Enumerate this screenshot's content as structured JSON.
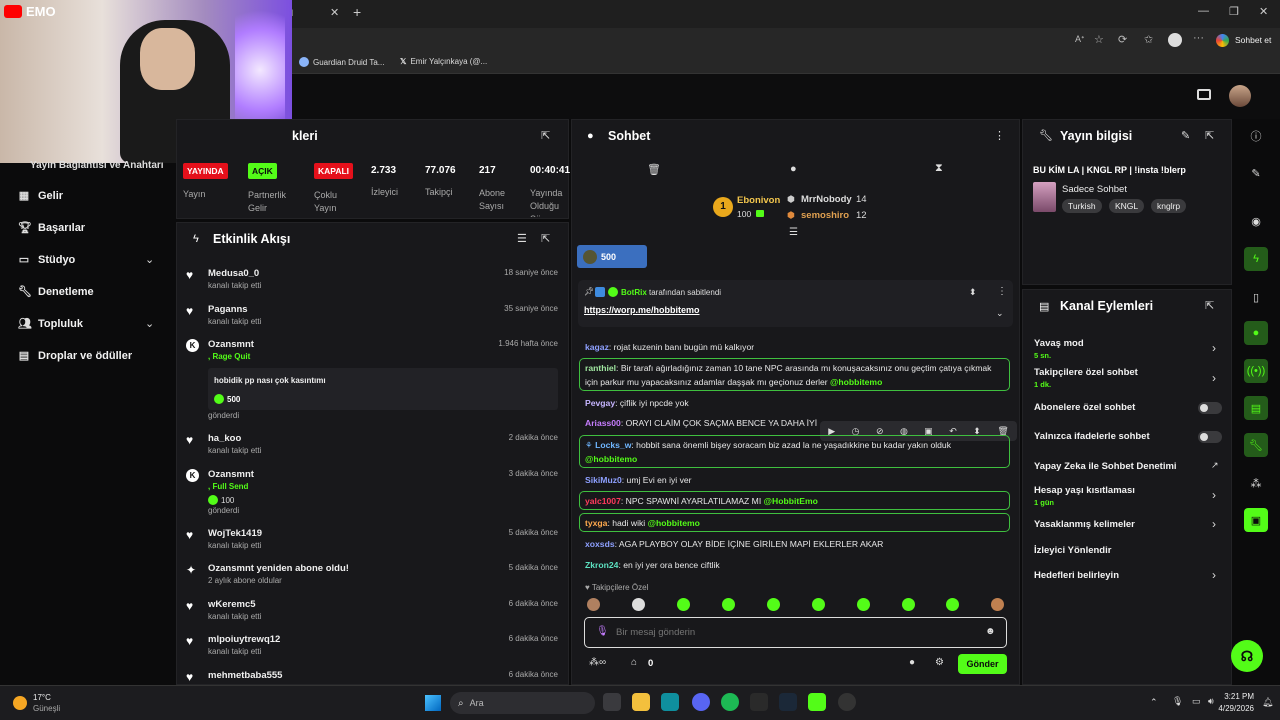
{
  "browser": {
    "tab_suffix": "d",
    "favorites": [
      "Guardian Druid Ta...",
      "Emir Yalçınkaya (@..."
    ],
    "chat_button": "Sohbet et"
  },
  "webcam": {
    "logo_text": "EMO"
  },
  "left_nav": {
    "partial_top": "Yayın Bağlantısı ve Anahtarı",
    "items": [
      {
        "label": "Gelir",
        "icon": "money-icon"
      },
      {
        "label": "Başarılar",
        "icon": "trophy-icon"
      },
      {
        "label": "Stüdyo",
        "icon": "studio-icon"
      },
      {
        "label": "Denetleme",
        "icon": "wrench-icon"
      },
      {
        "label": "Topluluk",
        "icon": "community-icon"
      },
      {
        "label": "Droplar ve ödüller",
        "icon": "drops-icon"
      }
    ]
  },
  "stats_panel": {
    "title_partial": "kleri",
    "badges": [
      {
        "text": "YAYINDA",
        "label": "Yayın",
        "color": "#e5101b"
      },
      {
        "text": "AÇIK",
        "label": "Partnerlik Gelir",
        "color": "#53fc18"
      },
      {
        "text": "KAPALI",
        "label": "Çoklu Yayın",
        "color": "#e5101b"
      }
    ],
    "stats": [
      {
        "value": "2.733",
        "label": "İzleyici"
      },
      {
        "value": "77.076",
        "label": "Takipçi"
      },
      {
        "value": "217",
        "label": "Abone Sayısı"
      },
      {
        "value": "00:40:41",
        "label": "Yayında Olduğu Süre"
      }
    ]
  },
  "activity": {
    "title": "Etkinlik Akışı",
    "events": [
      {
        "name": "Medusa0_0",
        "sub": "kanalı takip etti",
        "time": "18 saniye önce",
        "type": "follow"
      },
      {
        "name": "Paganns",
        "sub": "kanalı takip etti",
        "time": "35 saniye önce",
        "type": "follow"
      },
      {
        "name": "Ozansmnt",
        "sub": ", Rage Quit",
        "time": "1.946 hafta önce",
        "type": "kick",
        "message": "hobidik pp nası çok kasıntımı",
        "amount": "500",
        "footer": "gönderdi"
      },
      {
        "name": "ha_koo",
        "sub": "kanalı takip etti",
        "time": "2 dakika önce",
        "type": "follow"
      },
      {
        "name": "Ozansmnt",
        "sub": ", Full Send",
        "time": "3 dakika önce",
        "type": "kick",
        "amount": "100",
        "footer": "gönderdi"
      },
      {
        "name": "WojTek1419",
        "sub": "kanalı takip etti",
        "time": "5 dakika önce",
        "type": "follow"
      },
      {
        "name": "Ozansmnt yeniden abone oldu!",
        "sub": "2 aylık abone oldular",
        "time": "5 dakika önce",
        "type": "sub"
      },
      {
        "name": "wKeremc5",
        "sub": "kanalı takip etti",
        "time": "6 dakika önce",
        "type": "follow"
      },
      {
        "name": "mlpoiuytrewq12",
        "sub": "kanalı takip etti",
        "time": "6 dakika önce",
        "type": "follow"
      },
      {
        "name": "mehmetbaba555",
        "sub": "",
        "time": "6 dakika önce",
        "type": "follow"
      }
    ]
  },
  "chat": {
    "title": "Sohbet",
    "leaderboard": {
      "first": {
        "name": "Ebonivon",
        "amount": "100"
      },
      "second": {
        "name": "MrrNobody",
        "amount": "14"
      },
      "third": {
        "name": "semoshiro",
        "amount": "12"
      }
    },
    "gift_goal": "500",
    "pinned": {
      "by": "BotRix",
      "by_suffix": "tarafından sabitlendi",
      "link": "https://worp.me/hobbitemo"
    },
    "messages": [
      {
        "user": "kagaz",
        "color": "#8ea0ff",
        "text": ": rojat kuzenin banı bugün mü kalkıyor",
        "highlight": false
      },
      {
        "user": "ranthiel",
        "color": "#a0e6a0",
        "text": ": Bir tarafı ağırladığınız zaman 10 tane NPC arasında mı konuşacaksınız onu geçtim çatıya çıkmak için parkur mu yapacaksınız adamlar daşşak mı geçionuz derler ",
        "mention": "@hobbitemo",
        "highlight": true
      },
      {
        "user": "Pevgay",
        "color": "#c6b5ff",
        "text": ": çiflik iyi npcde yok",
        "highlight": false
      },
      {
        "user": "Ariass00",
        "color": "#c77dff",
        "text": ": ORAYI CLAİM ÇOK SAÇMA BENCE YA DAHA İYİ",
        "highlight": false
      },
      {
        "user": "Locks_w",
        "color": "#6fb6ff",
        "text": ": hobbit sana önemli bişey soracam biz azad la ne yaşadıkkine bu kadar yakın olduk ",
        "mention": "@hobbitemo",
        "highlight": true
      },
      {
        "user": "SikiMuz0",
        "color": "#8ea0ff",
        "text": ": umj Evi en iyi ver",
        "highlight": false
      },
      {
        "user": "yalc1007",
        "color": "#ff3b5c",
        "text": ": NPC SPAWNİ AYARLATILAMAZ MI ",
        "mention": "@HobbitEmo",
        "highlight": true
      },
      {
        "user": "tyxga",
        "color": "#ffa94d",
        "text": ": hadi wiki ",
        "mention": "@hobbitemo",
        "highlight": true
      },
      {
        "user": "xoxsds",
        "color": "#8ea0ff",
        "text": ": AGA PLAYBOY OLAY BİDE İÇİNE GİRİLEN MAPİ EKLERLER AKAR",
        "highlight": false
      },
      {
        "user": "Zkron24",
        "color": "#5ce0c0",
        "text": ": en iyi yer ora bence ciftlik",
        "highlight": false
      }
    ],
    "followers_only_label": "Takipçilere Özel",
    "input_placeholder": "Bir mesaj gönderin",
    "points": "0",
    "send_label": "Gönder"
  },
  "stream_info": {
    "title": "Yayın bilgisi",
    "stream_title": "BU KİM LA | KNGL RP | !insta !blerp",
    "category": "Sadece Sohbet",
    "tags": [
      "Turkish",
      "KNGL",
      "knglrp"
    ]
  },
  "channel_actions": {
    "title": "Kanal Eylemleri",
    "items": [
      {
        "label": "Yavaş mod",
        "sub": "5 sn.",
        "control": "chevron"
      },
      {
        "label": "Takipçilere özel sohbet",
        "sub": "1 dk.",
        "control": "chevron"
      },
      {
        "label": "Abonelere özel sohbet",
        "sub": "",
        "control": "toggle"
      },
      {
        "label": "Yalnızca ifadelerle sohbet",
        "sub": "",
        "control": "toggle"
      },
      {
        "label": "Yapay Zeka ile Sohbet Denetimi",
        "sub": "",
        "control": "external"
      },
      {
        "label": "Hesap yaşı kısıtlaması",
        "sub": "1 gün",
        "control": "chevron"
      },
      {
        "label": "Yasaklanmış kelimeler",
        "sub": "",
        "control": "chevron"
      },
      {
        "label": "İzleyici Yönlendir",
        "sub": "",
        "control": "none"
      },
      {
        "label": "Hedefleri belirleyin",
        "sub": "",
        "control": "chevron"
      }
    ]
  },
  "taskbar": {
    "weather_temp": "17°C",
    "weather_desc": "Güneşli",
    "search_placeholder": "Ara",
    "time": "3:21 PM",
    "date": "4/29/2026"
  },
  "colors": {
    "accent": "#53fc18",
    "live": "#e5101b",
    "panel": "#18181b"
  }
}
